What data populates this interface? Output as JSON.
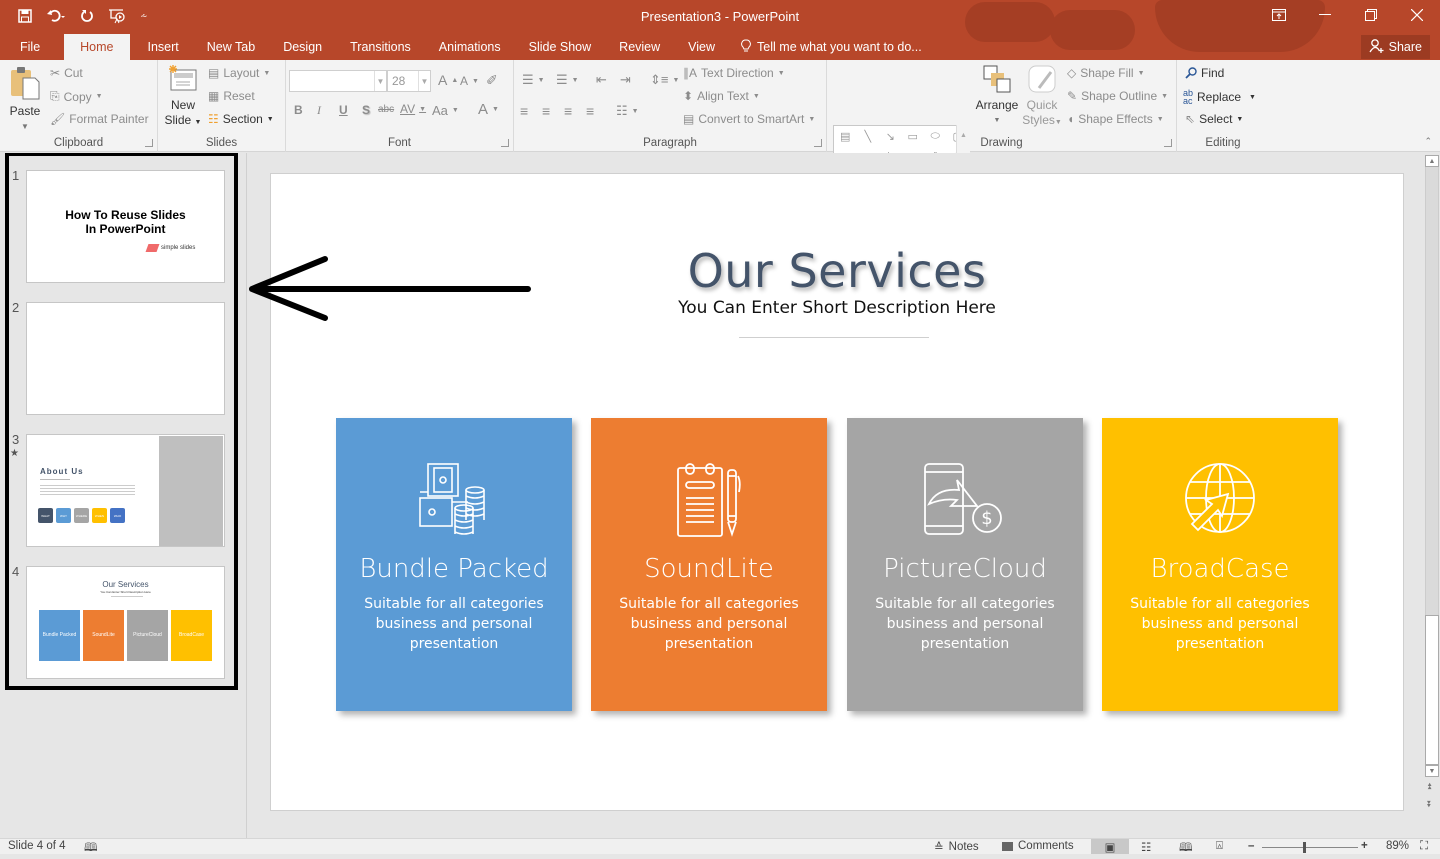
{
  "window": {
    "title": "Presentation3 - PowerPoint",
    "quick_access": [
      "save-icon",
      "undo-icon",
      "redo-icon",
      "start-from-beginning-icon",
      "customize-qat-icon"
    ],
    "controls": [
      "ribbon-display-options-icon",
      "minimize-icon",
      "restore-icon",
      "close-icon"
    ]
  },
  "ribbon_tabs": [
    "File",
    "Home",
    "Insert",
    "New Tab",
    "Design",
    "Transitions",
    "Animations",
    "Slide Show",
    "Review",
    "View"
  ],
  "active_tab": "Home",
  "tell_me": "Tell me what you want to do...",
  "share": "Share",
  "ribbon": {
    "clipboard": {
      "label": "Clipboard",
      "paste": "Paste",
      "cut": "Cut",
      "copy": "Copy",
      "format_painter": "Format Painter"
    },
    "slides": {
      "label": "Slides",
      "new_slide_1": "New",
      "new_slide_2": "Slide",
      "layout": "Layout",
      "reset": "Reset",
      "section": "Section"
    },
    "font": {
      "label": "Font",
      "font_name": "",
      "font_size": "28",
      "bold": "B",
      "italic": "I",
      "underline": "U",
      "shadow": "S",
      "strike": "abc",
      "spacing": "AV",
      "case": "Aa",
      "color": "A",
      "grow": "A",
      "shrink": "A"
    },
    "paragraph": {
      "label": "Paragraph",
      "text_direction": "Text Direction",
      "align_text": "Align Text",
      "convert_smartart": "Convert to SmartArt"
    },
    "drawing": {
      "label": "Drawing",
      "arrange": "Arrange",
      "quick_styles_1": "Quick",
      "quick_styles_2": "Styles",
      "shape_fill": "Shape Fill",
      "shape_outline": "Shape Outline",
      "shape_effects": "Shape Effects"
    },
    "editing": {
      "label": "Editing",
      "find": "Find",
      "replace": "Replace",
      "select": "Select"
    }
  },
  "thumbnails": [
    {
      "num": "1",
      "title_line1": "How To Reuse Slides",
      "title_line2": "In PowerPoint",
      "logo": "simple slides"
    },
    {
      "num": "2"
    },
    {
      "num": "3",
      "title": "About Us",
      "buttons": [
        "WHAT",
        "WHY",
        "WHERE",
        "WHEN",
        "WHO"
      ],
      "has_animation": true
    },
    {
      "num": "4",
      "title": "Our Services",
      "subtitle": "You Can Enter Short Description Here",
      "cards": [
        "Bundle Packed",
        "SoundLite",
        "PictureCloud",
        "BroadCase"
      ]
    }
  ],
  "slide": {
    "title": "Our Services",
    "subtitle": "You Can Enter Short Description Here",
    "cards": [
      {
        "name": "Bundle Packed",
        "desc": "Suitable for all categories business and personal presentation",
        "color": "#5b9bd5",
        "icon": "money-bundle-icon"
      },
      {
        "name": "SoundLite",
        "desc": "Suitable for all categories business and personal presentation",
        "color": "#ed7d31",
        "icon": "clipboard-pen-icon"
      },
      {
        "name": "PictureCloud",
        "desc": "Suitable for all categories business and personal presentation",
        "color": "#a5a5a5",
        "icon": "phone-payment-icon"
      },
      {
        "name": "BroadCase",
        "desc": "Suitable for all categories business and personal presentation",
        "color": "#ffc000",
        "icon": "globe-cursor-icon"
      }
    ]
  },
  "status": {
    "slide_of": "Slide 4 of 4",
    "notes": "Notes",
    "comments": "Comments",
    "zoom": "89%",
    "zoom_level_percent": 89
  },
  "colors": {
    "accent": "#b7472a"
  }
}
